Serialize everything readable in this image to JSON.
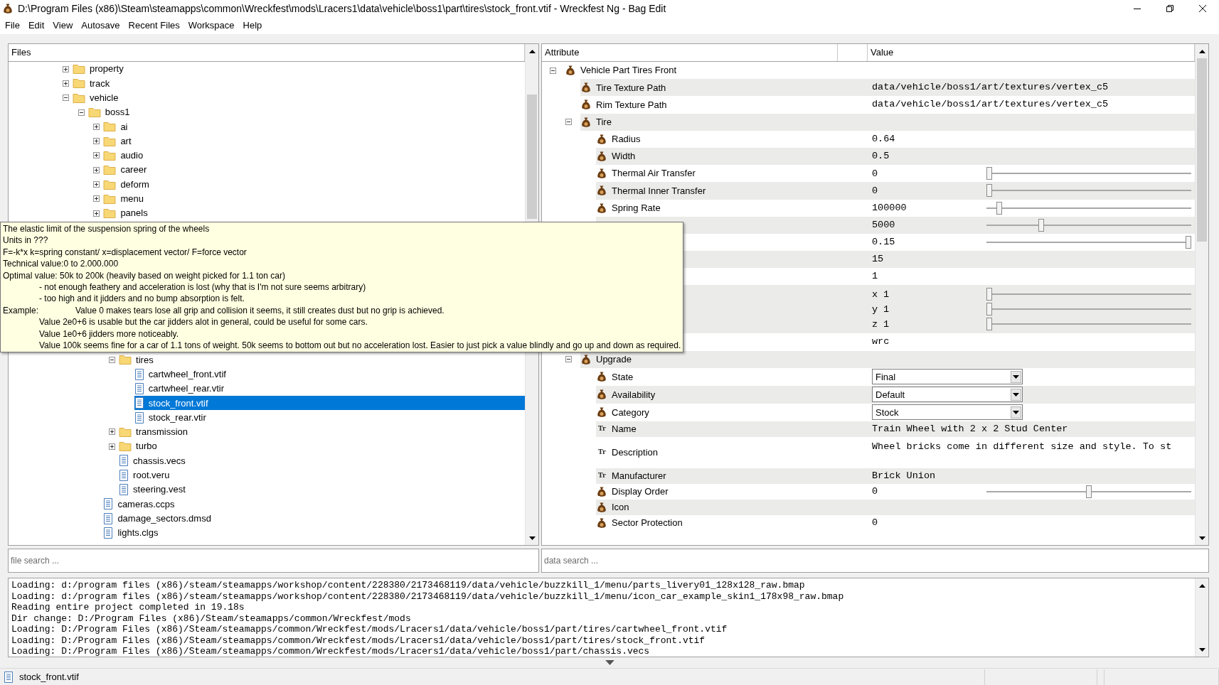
{
  "window": {
    "title": "D:\\Program Files (x86)\\Steam\\steamapps\\common\\Wreckfest\\mods\\Lracers1\\data\\vehicle\\boss1\\part\\tires\\stock_front.vtif - Wreckfest Ng - Bag Edit"
  },
  "menu": [
    "File",
    "Edit",
    "View",
    "Autosave",
    "Recent Files",
    "Workspace",
    "Help"
  ],
  "files": {
    "header": "Files",
    "items": [
      {
        "kind": "folder",
        "label": "property",
        "expanded": false,
        "selected": false
      },
      {
        "kind": "folder",
        "label": "track",
        "expanded": false,
        "selected": false
      },
      {
        "kind": "folder",
        "label": "vehicle",
        "expanded": true,
        "selected": false,
        "children": [
          {
            "kind": "folder",
            "label": "boss1",
            "expanded": true,
            "selected": false,
            "children": [
              {
                "kind": "folder",
                "label": "ai",
                "expanded": false,
                "selected": false
              },
              {
                "kind": "folder",
                "label": "art",
                "expanded": false,
                "selected": false
              },
              {
                "kind": "folder",
                "label": "audio",
                "expanded": false,
                "selected": false
              },
              {
                "kind": "folder",
                "label": "career",
                "expanded": false,
                "selected": false
              },
              {
                "kind": "folder",
                "label": "deform",
                "expanded": false,
                "selected": false
              },
              {
                "kind": "folder",
                "label": "menu",
                "expanded": false,
                "selected": false
              },
              {
                "kind": "folder",
                "label": "panels",
                "expanded": false,
                "selected": false
              },
              {
                "kind": "gap",
                "children": [
                  {
                    "kind": "folder",
                    "label": "tires",
                    "expanded": true,
                    "selected": false,
                    "children": [
                      {
                        "kind": "file",
                        "label": "cartwheel_front.vtif",
                        "selected": false
                      },
                      {
                        "kind": "file",
                        "label": "cartwheel_rear.vtir",
                        "selected": false
                      },
                      {
                        "kind": "file",
                        "label": "stock_front.vtif",
                        "selected": true
                      },
                      {
                        "kind": "file",
                        "label": "stock_rear.vtir",
                        "selected": false
                      }
                    ]
                  },
                  {
                    "kind": "folder",
                    "label": "transmission",
                    "expanded": false,
                    "selected": false
                  },
                  {
                    "kind": "folder",
                    "label": "turbo",
                    "expanded": false,
                    "selected": false
                  },
                  {
                    "kind": "file",
                    "label": "chassis.vecs",
                    "selected": false
                  },
                  {
                    "kind": "file",
                    "label": "root.veru",
                    "selected": false
                  },
                  {
                    "kind": "file",
                    "label": "steering.vest",
                    "selected": false
                  }
                ]
              },
              {
                "kind": "file",
                "label": "cameras.ccps",
                "selected": false
              },
              {
                "kind": "file",
                "label": "damage_sectors.dmsd",
                "selected": false
              },
              {
                "kind": "file",
                "label": "lights.clgs",
                "selected": false
              }
            ]
          }
        ]
      }
    ]
  },
  "attributes": {
    "columns": [
      "Attribute",
      "Value"
    ],
    "rows": [
      {
        "kind": "group",
        "label": "Vehicle Part Tires Front",
        "expanded": true,
        "children": [
          {
            "kind": "value",
            "label": "Tire Texture Path",
            "value": "data/vehicle/boss1/art/textures/vertex_c5"
          },
          {
            "kind": "value",
            "label": "Rim Texture Path",
            "value": "data/vehicle/boss1/art/textures/vertex_c5"
          },
          {
            "kind": "group",
            "label": "Tire",
            "expanded": true,
            "children": [
              {
                "kind": "value",
                "label": "Radius",
                "value": "0.64"
              },
              {
                "kind": "value",
                "label": "Width",
                "value": "0.5"
              },
              {
                "kind": "slider",
                "label": "Thermal Air Transfer",
                "value": "0",
                "level": 0
              },
              {
                "kind": "slider",
                "label": "Thermal Inner Transfer",
                "value": "0",
                "level": 0
              },
              {
                "kind": "slider",
                "label": "Spring Rate",
                "value": "100000",
                "level": 0.05
              },
              {
                "kind": "slider",
                "value": "5000",
                "level": 0.26
              },
              {
                "kind": "slider",
                "value": "0.15",
                "level": 1
              },
              {
                "kind": "value",
                "value": "15"
              },
              {
                "kind": "value",
                "value": "1"
              },
              {
                "kind": "vector",
                "components": [
                  {
                    "axis": "x",
                    "value": "1",
                    "level": 0
                  },
                  {
                    "axis": "y",
                    "value": "1",
                    "level": 0
                  },
                  {
                    "axis": "z",
                    "value": "1",
                    "level": 0
                  }
                ]
              },
              {
                "kind": "value",
                "value": "wrc"
              }
            ]
          },
          {
            "kind": "group",
            "label": "Upgrade",
            "expanded": true,
            "children": [
              {
                "kind": "dropdown",
                "label": "State",
                "value": "Final"
              },
              {
                "kind": "dropdown",
                "label": "Availability",
                "value": "Default"
              },
              {
                "kind": "dropdown",
                "label": "Category",
                "value": "Stock"
              },
              {
                "kind": "text",
                "badge": "Tr",
                "label": "Name",
                "value": "Train Wheel with 2 x 2 Stud Center"
              },
              {
                "kind": "multiline",
                "badge": "Tr",
                "label": "Description",
                "value": "Wheel bricks come in different size and style. To st"
              },
              {
                "kind": "text",
                "badge": "Tr",
                "label": "Manufacturer",
                "value": "Brick Union"
              },
              {
                "kind": "slider",
                "label": "Display Order",
                "value": "0",
                "level": 0.5
              },
              {
                "kind": "value",
                "label": "Icon"
              },
              {
                "kind": "value",
                "label": "Sector Protection",
                "value": "0"
              }
            ]
          }
        ]
      }
    ]
  },
  "file_search": {
    "placeholder": "file search ..."
  },
  "data_search": {
    "placeholder": "data search ..."
  },
  "log": [
    "Loading: d:/program files (x86)/steam/steamapps/workshop/content/228380/2173468119/data/vehicle/buzzkill_1/menu/parts_livery01_128x128_raw.bmap",
    "Loading: d:/program files (x86)/steam/steamapps/workshop/content/228380/2173468119/data/vehicle/buzzkill_1/menu/icon_car_example_skin1_178x98_raw.bmap",
    "Reading entire project completed in 19.18s",
    "Dir change: D:/Program Files (x86)/Steam/steamapps/common/Wreckfest/mods",
    "Loading: D:/Program Files (x86)/Steam/steamapps/common/Wreckfest/mods/Lracers1/data/vehicle/boss1/part/tires/cartwheel_front.vtif",
    "Loading: D:/Program Files (x86)/Steam/steamapps/common/Wreckfest/mods/Lracers1/data/vehicle/boss1/part/tires/stock_front.vtif",
    "Loading: D:/Program Files (x86)/Steam/steamapps/common/Wreckfest/mods/Lracers1/data/vehicle/boss1/part/chassis.vecs"
  ],
  "tooltip": {
    "lines": [
      {
        "kind": "plain",
        "text": "The elastic limit of the suspension spring of the wheels"
      },
      {
        "kind": "plain",
        "text": "Units in ???"
      },
      {
        "kind": "plain",
        "text": "F=-k*x k=spring constant/ x=displacement vector/ F=force vector"
      },
      {
        "kind": "plain",
        "text": "Technical value:0 to 2.000.000"
      },
      {
        "kind": "plain",
        "text": "Optimal value: 50k to 200k (heavily based on weight picked for 1.1 ton car)"
      },
      {
        "kind": "indented",
        "text": "- not enough feathery and acceleration is lost (why that is I'm not sure seems arbitrary)"
      },
      {
        "kind": "indented",
        "text": "- too high and it jidders and no bump absorption is felt."
      },
      {
        "kind": "example",
        "term": "Example:",
        "text": "Value 0 makes tears lose all grip and collision it seems, it still creates dust but no grip is achieved."
      },
      {
        "kind": "indented",
        "text": "Value 2e0+6 is usable but the car jidders alot in general, could be useful for some cars."
      },
      {
        "kind": "indented",
        "text": "Value 1e0+6 jidders more noticeably."
      },
      {
        "kind": "indented",
        "text": "Value 100k seems fine for a car of 1.1 tons of weight. 50k seems to bottom out but no acceleration lost. Easier to just pick a value blindly and go up and down as required."
      }
    ]
  },
  "status_bar": {
    "file": "stock_front.vtif"
  }
}
